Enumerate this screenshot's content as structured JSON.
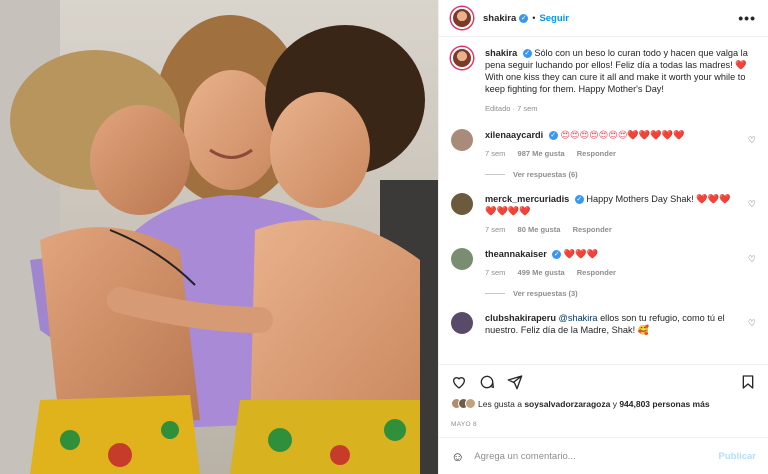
{
  "post": {
    "username": "shakira",
    "follow_label": "Seguir",
    "more_label": "•••",
    "caption_prefix": "Sólo con un beso lo curan todo y hacen que valga la pena seguir luchando por ellos! Feliz día a todas las madres!",
    "caption_heart": "❤️",
    "caption_english": "With one kiss they can cure it all and make it worth your while to keep fighting for them. Happy Mother's Day!",
    "caption_meta": "Editado · 7 sem"
  },
  "comments": [
    {
      "user": "xilenaaycardi",
      "text": "😍😍😍😍😍😍😍❤️❤️❤️❤️❤️",
      "time": "7 sem",
      "likes": "987 Me gusta",
      "reply": "Responder",
      "view_replies": "Ver respuestas (6)",
      "avatar_color": "#a98b7a"
    },
    {
      "user": "merck_mercuriadis",
      "text": "Happy Mothers Day Shak!",
      "hearts": "❤️❤️❤️❤️❤️❤️❤️",
      "time": "7 sem",
      "likes": "80 Me gusta",
      "reply": "Responder",
      "avatar_color": "#6b5a3c"
    },
    {
      "user": "theannakaiser",
      "text": "❤️❤️❤️",
      "time": "7 sem",
      "likes": "499 Me gusta",
      "reply": "Responder",
      "view_replies": "Ver respuestas (3)",
      "avatar_color": "#7a8d70"
    },
    {
      "user": "clubshakiraperu",
      "mention": "@shakira",
      "text": "ellos son tu refugio, como tú el nuestro. Feliz día de la Madre, Shak! 🥰",
      "avatar_color": "#5a4a6a"
    }
  ],
  "likes_bar": {
    "prefix": "Les gusta a",
    "user": "soysalvadorzaragoza",
    "mid": "y",
    "count": "944,803 personas más"
  },
  "date": "MAYO 8",
  "add_comment": {
    "placeholder": "Agrega un comentario...",
    "post_label": "Publicar"
  },
  "icons": {
    "like": "heart-icon",
    "comment": "comment-icon",
    "share": "share-icon",
    "save": "bookmark-icon",
    "emoji": "emoji-icon"
  },
  "colors": {
    "link_blue": "#0095f6",
    "heart_red": "#ed4956",
    "muted": "#8e8e8e",
    "post_disabled": "#b2dffc"
  }
}
